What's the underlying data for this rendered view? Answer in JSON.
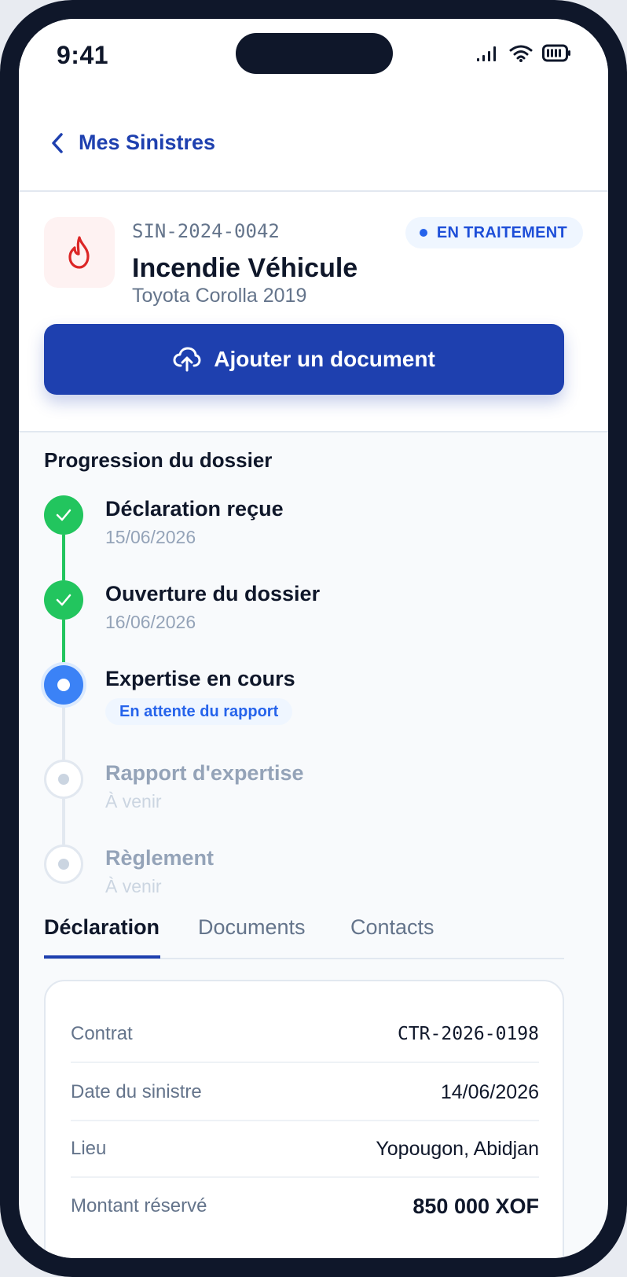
{
  "status_bar": {
    "time": "9:41"
  },
  "nav": {
    "back_label": "Mes Sinistres"
  },
  "claim": {
    "reference": "SIN-2024-0042",
    "title": "Incendie Véhicule",
    "subtitle": "Toyota Corolla 2019",
    "status": "EN TRAITEMENT",
    "icon": "flame-icon"
  },
  "upload_button": {
    "label": "Ajouter un document",
    "icon": "cloud-upload-icon"
  },
  "progress": {
    "title": "Progression du dossier",
    "steps": [
      {
        "title": "Déclaration reçue",
        "sub": "15/06/2026",
        "state": "done"
      },
      {
        "title": "Ouverture du dossier",
        "sub": "16/06/2026",
        "state": "done"
      },
      {
        "title": "Expertise en cours",
        "sub": "En attente du rapport",
        "state": "current"
      },
      {
        "title": "Rapport d'expertise",
        "sub": "À venir",
        "state": "pending"
      },
      {
        "title": "Règlement",
        "sub": "À venir",
        "state": "pending"
      }
    ]
  },
  "tabs": [
    {
      "label": "Déclaration",
      "active": true
    },
    {
      "label": "Documents",
      "active": false
    },
    {
      "label": "Contacts",
      "active": false
    }
  ],
  "details": [
    {
      "label": "Contrat",
      "value": "CTR-2026-0198"
    },
    {
      "label": "Date du sinistre",
      "value": "14/06/2026"
    },
    {
      "label": "Lieu",
      "value": "Yopougon, Abidjan"
    },
    {
      "label": "Montant réservé",
      "value": "850 000 XOF"
    }
  ],
  "colors": {
    "primary": "#1e40af",
    "success": "#22c55e",
    "current": "#3b82f6",
    "danger": "#dc2626"
  }
}
